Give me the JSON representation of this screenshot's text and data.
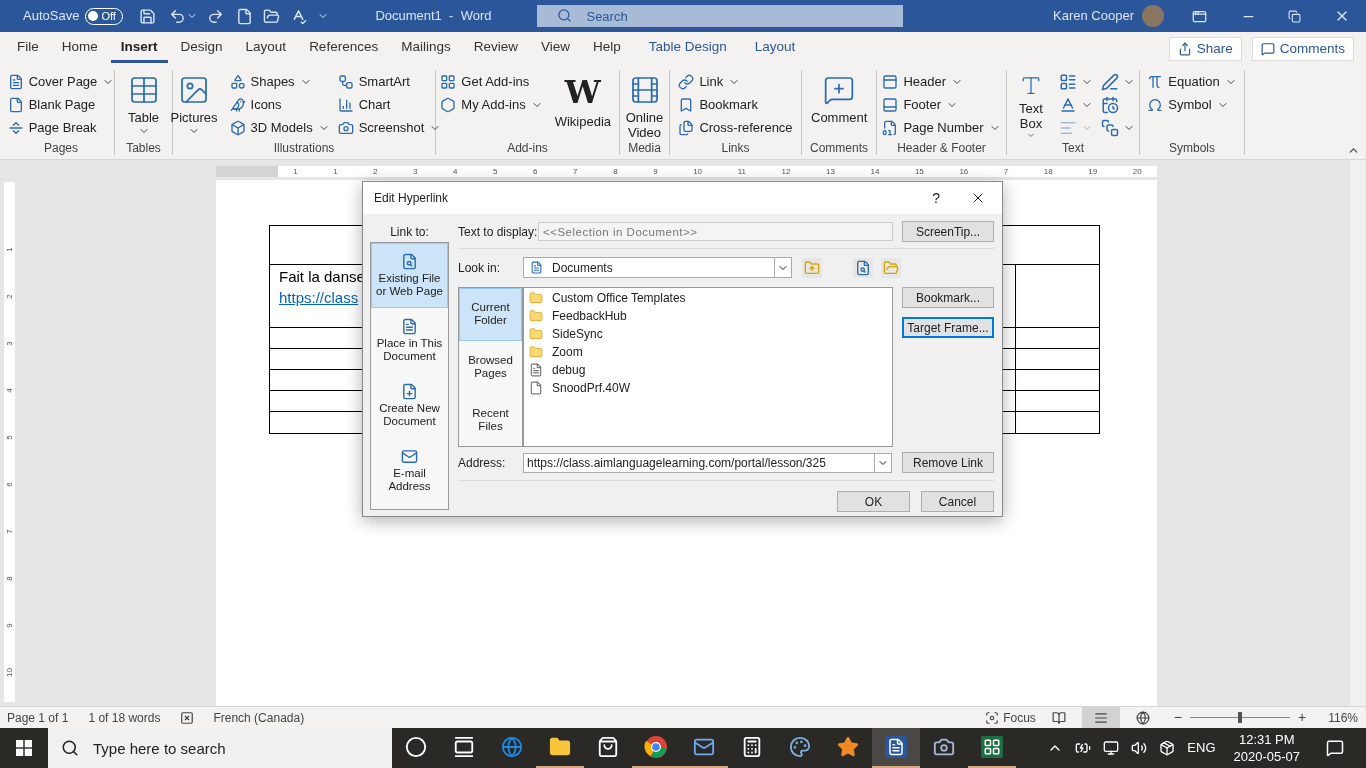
{
  "titlebar": {
    "autosave_label": "AutoSave",
    "autosave_toggle": {
      "label": "Off",
      "on": false
    },
    "document_title": "Document1  -  Word",
    "search": {
      "placeholder": "Search"
    },
    "user_name": "Karen Cooper"
  },
  "ribbon_tabs": [
    {
      "label": "File",
      "selected": false,
      "kind": "normal"
    },
    {
      "label": "Home",
      "selected": false,
      "kind": "normal"
    },
    {
      "label": "Insert",
      "selected": true,
      "kind": "normal"
    },
    {
      "label": "Design",
      "selected": false,
      "kind": "normal"
    },
    {
      "label": "Layout",
      "selected": false,
      "kind": "normal"
    },
    {
      "label": "References",
      "selected": false,
      "kind": "normal"
    },
    {
      "label": "Mailings",
      "selected": false,
      "kind": "normal"
    },
    {
      "label": "Review",
      "selected": false,
      "kind": "normal"
    },
    {
      "label": "View",
      "selected": false,
      "kind": "normal"
    },
    {
      "label": "Help",
      "selected": false,
      "kind": "normal"
    },
    {
      "label": "Table Design",
      "selected": false,
      "kind": "context"
    },
    {
      "label": "Layout",
      "selected": false,
      "kind": "context"
    }
  ],
  "share_button": "Share",
  "comments_button": "Comments",
  "ribbon_groups": [
    {
      "label": "Pages",
      "columns": [
        [
          {
            "kind": "small",
            "label": "Cover Page",
            "dropdown": true
          },
          {
            "kind": "small",
            "label": "Blank Page",
            "dropdown": false
          },
          {
            "kind": "small",
            "label": "Page Break",
            "dropdown": false
          }
        ]
      ]
    },
    {
      "label": "Tables",
      "columns": [
        [
          {
            "kind": "large",
            "label": "Table",
            "dropdown": true
          }
        ]
      ]
    },
    {
      "label": "Illustrations",
      "columns": [
        [
          {
            "kind": "large",
            "label": "Pictures",
            "dropdown": true
          }
        ],
        [
          {
            "kind": "small",
            "label": "Shapes",
            "dropdown": true
          },
          {
            "kind": "small",
            "label": "Icons",
            "dropdown": false
          },
          {
            "kind": "small",
            "label": "3D Models",
            "dropdown": true
          }
        ],
        [
          {
            "kind": "small",
            "label": "SmartArt",
            "dropdown": false
          },
          {
            "kind": "small",
            "label": "Chart",
            "dropdown": false
          },
          {
            "kind": "small",
            "label": "Screenshot",
            "dropdown": true
          }
        ]
      ]
    },
    {
      "label": "Add-ins",
      "columns": [
        [
          {
            "kind": "small",
            "label": "Get Add-ins",
            "dropdown": false
          },
          {
            "kind": "small",
            "label": "My Add-ins",
            "dropdown": true
          }
        ],
        [
          {
            "kind": "large",
            "label": "Wikipedia",
            "logo": "W",
            "dropdown": false
          }
        ]
      ]
    },
    {
      "label": "Media",
      "columns": [
        [
          {
            "kind": "large",
            "label": "Online Video",
            "dropdown": false
          }
        ]
      ]
    },
    {
      "label": "Links",
      "columns": [
        [
          {
            "kind": "small",
            "label": "Link",
            "dropdown": true
          },
          {
            "kind": "small",
            "label": "Bookmark",
            "dropdown": false
          },
          {
            "kind": "small",
            "label": "Cross-reference",
            "dropdown": false
          }
        ]
      ]
    },
    {
      "label": "Comments",
      "columns": [
        [
          {
            "kind": "large",
            "label": "Comment",
            "dropdown": false
          }
        ]
      ]
    },
    {
      "label": "Header & Footer",
      "columns": [
        [
          {
            "kind": "small",
            "label": "Header",
            "dropdown": true
          },
          {
            "kind": "small",
            "label": "Footer",
            "dropdown": true
          },
          {
            "kind": "small",
            "label": "Page Number",
            "dropdown": true
          }
        ]
      ]
    },
    {
      "label": "Text",
      "columns": [
        [
          {
            "kind": "large",
            "label": "Text Box",
            "dropdown": true
          }
        ],
        [
          {
            "kind": "icon",
            "dropdown": true,
            "disabled": false
          },
          {
            "kind": "icon",
            "dropdown": true,
            "disabled": false
          },
          {
            "kind": "icon",
            "dropdown": true,
            "disabled": true
          }
        ],
        [
          {
            "kind": "icon",
            "dropdown": true,
            "disabled": false
          },
          {
            "kind": "icon",
            "dropdown": false,
            "disabled": false
          },
          {
            "kind": "icon",
            "dropdown": true,
            "disabled": false
          }
        ]
      ]
    },
    {
      "label": "Symbols",
      "columns": [
        [
          {
            "kind": "small",
            "label": "Equation",
            "dropdown": true
          },
          {
            "kind": "small",
            "label": "Symbol",
            "dropdown": true
          }
        ]
      ]
    }
  ],
  "ruler": {
    "horizontal": [
      "1",
      "1",
      "2",
      "3",
      "4",
      "5",
      "6",
      "7",
      "8",
      "9",
      "10",
      "11",
      "12",
      "13",
      "14",
      "15",
      "16",
      "7",
      "18",
      "19",
      "20"
    ],
    "vertical": [
      "1",
      "2",
      "3",
      "4",
      "5",
      "6",
      "7",
      "8",
      "9",
      "10"
    ]
  },
  "document": {
    "cell_text": "Fait la danse",
    "link_text": "https://class"
  },
  "dialog": {
    "title": "Edit Hyperlink",
    "help": "?",
    "link_to_label": "Link to:",
    "link_to": [
      {
        "label": "Existing File or Web Page",
        "selected": true
      },
      {
        "label": "Place in This Document",
        "selected": false
      },
      {
        "label": "Create New Document",
        "selected": false
      },
      {
        "label": "E-mail Address",
        "selected": false
      }
    ],
    "text_to_display": {
      "label": "Text to display:",
      "value": "<<Selection in Document>>"
    },
    "look_in": {
      "label": "Look in:",
      "value": "Documents"
    },
    "browse_tabs": [
      {
        "label": "Current Folder",
        "selected": true
      },
      {
        "label": "Browsed Pages",
        "selected": false
      },
      {
        "label": "Recent Files",
        "selected": false
      }
    ],
    "files": [
      {
        "name": "Custom Office Templates",
        "kind": "folder"
      },
      {
        "name": "FeedbackHub",
        "kind": "folder"
      },
      {
        "name": "SideSync",
        "kind": "folder"
      },
      {
        "name": "Zoom",
        "kind": "folder"
      },
      {
        "name": "debug",
        "kind": "text"
      },
      {
        "name": "SnoodPrf.40W",
        "kind": "file"
      }
    ],
    "address": {
      "label": "Address:",
      "value": "https://class.aimlanguagelearning.com/portal/lesson/325"
    },
    "side_buttons": [
      {
        "label": "ScreenTip...",
        "focused": false
      },
      {
        "label": "Bookmark...",
        "focused": false
      },
      {
        "label": "Target Frame...",
        "focused": true
      },
      {
        "label": "Remove Link",
        "focused": false
      }
    ],
    "ok": "OK",
    "cancel": "Cancel"
  },
  "status_bar": {
    "page": "Page 1 of 1",
    "words": "1 of 18 words",
    "language": "French (Canada)",
    "focus": "Focus",
    "views": [
      {
        "selected": false
      },
      {
        "selected": true
      },
      {
        "selected": false
      }
    ],
    "zoom_out": "−",
    "zoom_in": "+",
    "zoom_slider": {
      "level": 0.5
    },
    "zoom": "116%"
  },
  "taskbar": {
    "search": {
      "placeholder": "Type here to search"
    },
    "apps": [
      {
        "running": false,
        "selected": false
      },
      {
        "running": false,
        "selected": false
      },
      {
        "running": false,
        "selected": false
      },
      {
        "running": true,
        "selected": false
      },
      {
        "running": false,
        "selected": false
      },
      {
        "running": true,
        "selected": false
      },
      {
        "running": true,
        "selected": false
      },
      {
        "running": false,
        "selected": false
      },
      {
        "running": false,
        "selected": false
      },
      {
        "running": false,
        "selected": false
      },
      {
        "running": true,
        "selected": true
      },
      {
        "running": false,
        "selected": false
      },
      {
        "running": true,
        "selected": false
      }
    ],
    "language": "ENG",
    "time": "12:31 PM",
    "date": "2020-05-07"
  }
}
